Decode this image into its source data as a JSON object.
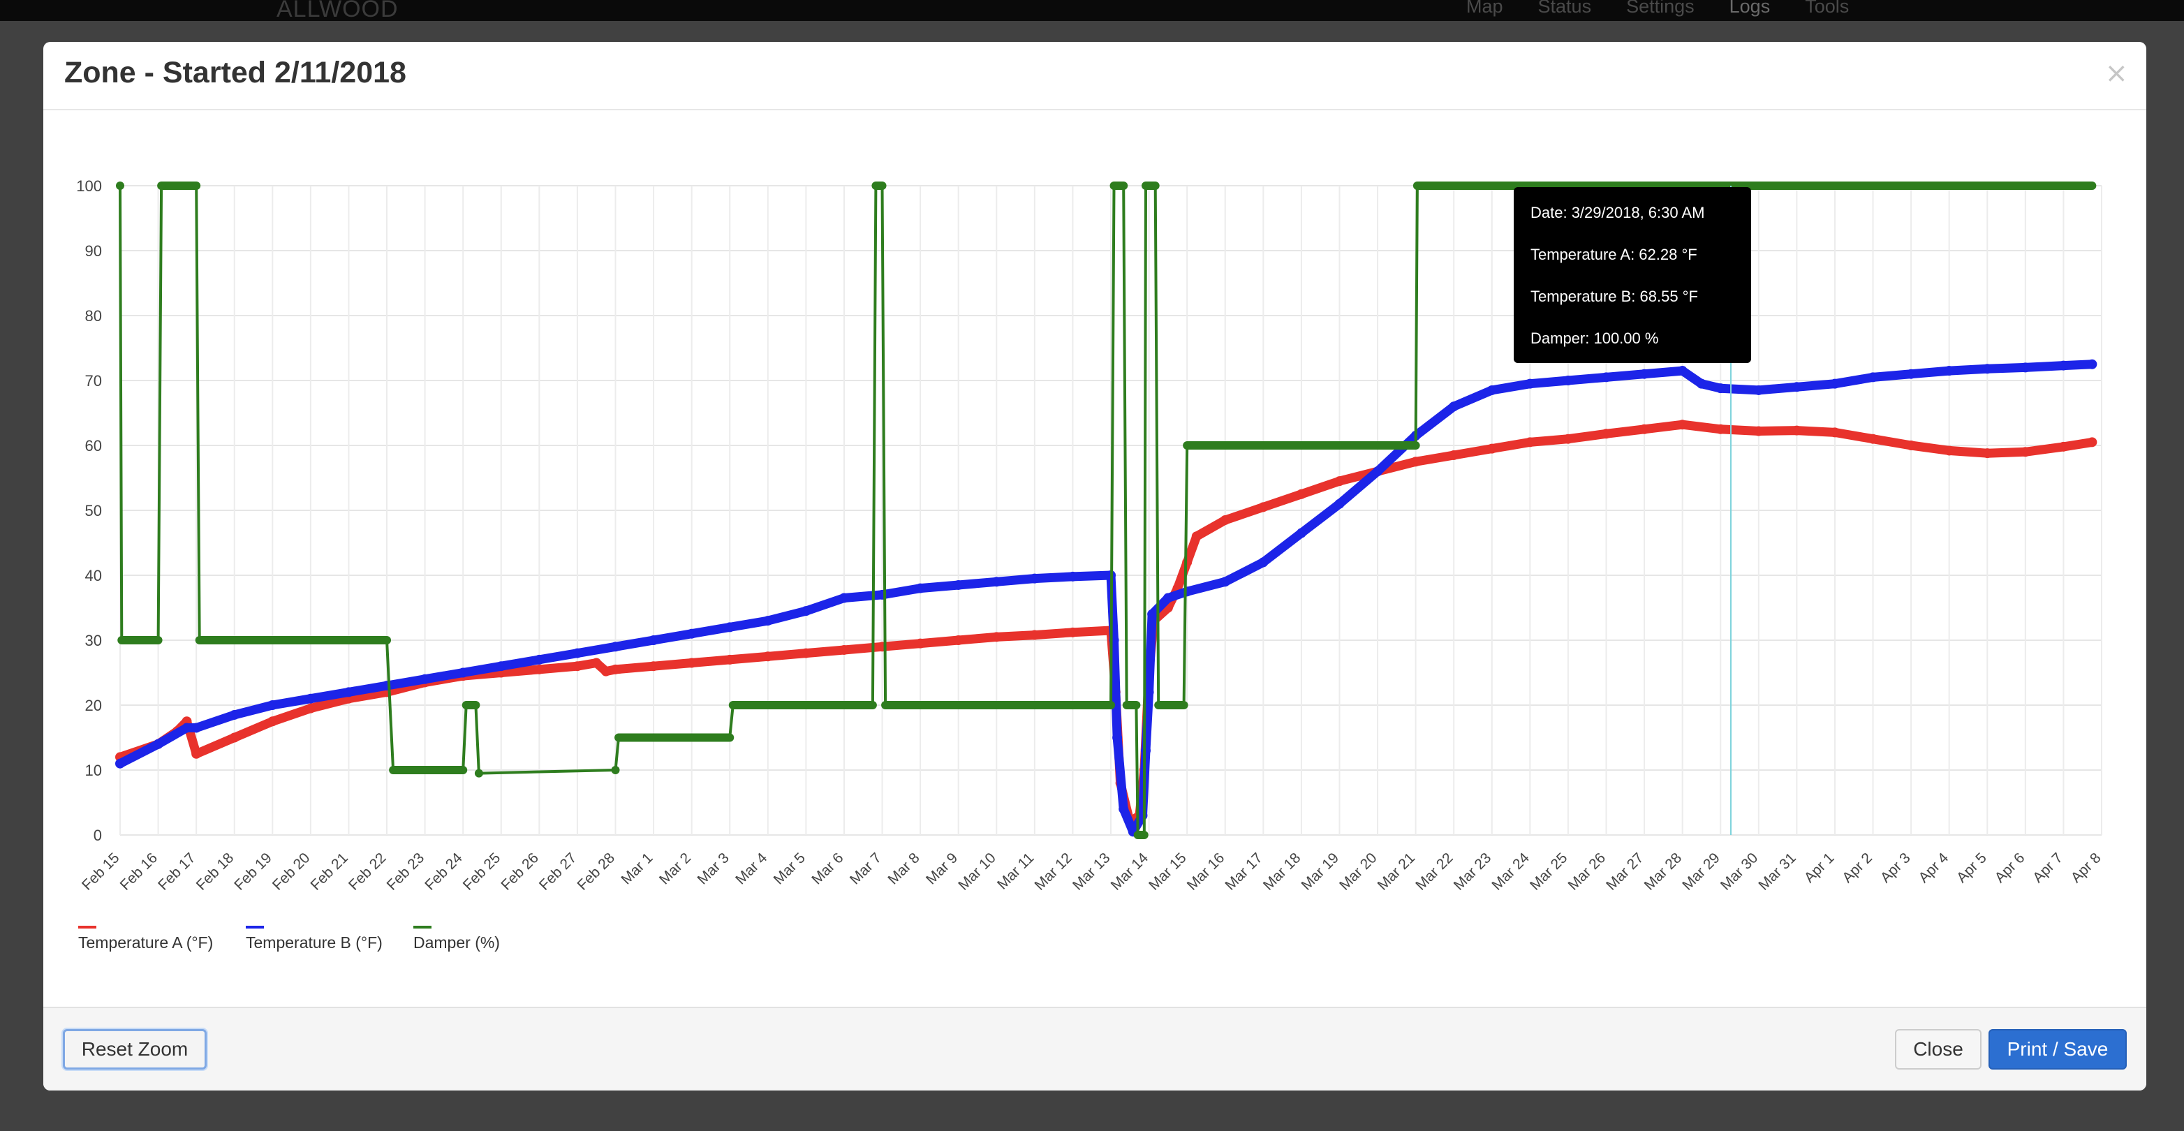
{
  "navbar": {
    "brand": "ALLWOOD",
    "items": [
      {
        "label": "Map",
        "active": false
      },
      {
        "label": "Status",
        "active": false
      },
      {
        "label": "Settings",
        "active": false
      },
      {
        "label": "Logs",
        "active": true
      },
      {
        "label": "Tools",
        "active": false
      }
    ]
  },
  "modal": {
    "title": "Zone - Started 2/11/2018",
    "close_glyph": "×"
  },
  "footer": {
    "reset_zoom_label": "Reset Zoom",
    "close_label": "Close",
    "print_save_label": "Print / Save"
  },
  "chart_data": {
    "type": "line",
    "title": "",
    "xlabel": "",
    "ylabel": "",
    "ylim": [
      0,
      100
    ],
    "yticks": [
      0,
      10,
      20,
      30,
      40,
      50,
      60,
      70,
      80,
      90,
      100
    ],
    "grid": true,
    "legend_position": "bottom-left",
    "x_tick_labels": [
      "Feb 15",
      "Feb 16",
      "Feb 17",
      "Feb 18",
      "Feb 19",
      "Feb 20",
      "Feb 21",
      "Feb 22",
      "Feb 23",
      "Feb 24",
      "Feb 25",
      "Feb 26",
      "Feb 27",
      "Feb 28",
      "Mar 1",
      "Mar 2",
      "Mar 3",
      "Mar 4",
      "Mar 5",
      "Mar 6",
      "Mar 7",
      "Mar 8",
      "Mar 9",
      "Mar 10",
      "Mar 11",
      "Mar 12",
      "Mar 13",
      "Mar 14",
      "Mar 15",
      "Mar 16",
      "Mar 17",
      "Mar 18",
      "Mar 19",
      "Mar 20",
      "Mar 21",
      "Mar 22",
      "Mar 23",
      "Mar 24",
      "Mar 25",
      "Mar 26",
      "Mar 27",
      "Mar 28",
      "Mar 29",
      "Mar 30",
      "Mar 31",
      "Apr 1",
      "Apr 2",
      "Apr 3",
      "Apr 4",
      "Apr 5",
      "Apr 6",
      "Apr 7",
      "Apr 8"
    ],
    "series": [
      {
        "name": "Temperature A (°F)",
        "color": "#e8322c",
        "points": [
          [
            "2018-02-15",
            12
          ],
          [
            "2018-02-16",
            14
          ],
          [
            "2018-02-16 12:00",
            16
          ],
          [
            "2018-02-16 18:00",
            17.5
          ],
          [
            "2018-02-17",
            12.5
          ],
          [
            "2018-02-18",
            15
          ],
          [
            "2018-02-19",
            17.5
          ],
          [
            "2018-02-20",
            19.5
          ],
          [
            "2018-02-21",
            21
          ],
          [
            "2018-02-22",
            22
          ],
          [
            "2018-02-23",
            23.5
          ],
          [
            "2018-02-24",
            24.5
          ],
          [
            "2018-02-25",
            25
          ],
          [
            "2018-02-26",
            25.5
          ],
          [
            "2018-02-27",
            26
          ],
          [
            "2018-02-27 12:00",
            26.5
          ],
          [
            "2018-02-27 18:00",
            25.2
          ],
          [
            "2018-02-28",
            25.5
          ],
          [
            "2018-03-01",
            26
          ],
          [
            "2018-03-02",
            26.5
          ],
          [
            "2018-03-03",
            27
          ],
          [
            "2018-03-04",
            27.5
          ],
          [
            "2018-03-05",
            28
          ],
          [
            "2018-03-06",
            28.5
          ],
          [
            "2018-03-07",
            29
          ],
          [
            "2018-03-08",
            29.5
          ],
          [
            "2018-03-09",
            30
          ],
          [
            "2018-03-10",
            30.5
          ],
          [
            "2018-03-11",
            30.8
          ],
          [
            "2018-03-12",
            31.2
          ],
          [
            "2018-03-13",
            31.5
          ],
          [
            "2018-03-13 03:00",
            22
          ],
          [
            "2018-03-13 06:00",
            8
          ],
          [
            "2018-03-13 12:00",
            2
          ],
          [
            "2018-03-13 18:00",
            3
          ],
          [
            "2018-03-13 21:00",
            10
          ],
          [
            "2018-03-14",
            25
          ],
          [
            "2018-03-14 03:00",
            33
          ],
          [
            "2018-03-14 12:00",
            35
          ],
          [
            "2018-03-14 18:00",
            38
          ],
          [
            "2018-03-15",
            42
          ],
          [
            "2018-03-15 06:00",
            46
          ],
          [
            "2018-03-16",
            48.5
          ],
          [
            "2018-03-17",
            50.5
          ],
          [
            "2018-03-18",
            52.5
          ],
          [
            "2018-03-19",
            54.5
          ],
          [
            "2018-03-20",
            56
          ],
          [
            "2018-03-21",
            57.5
          ],
          [
            "2018-03-22",
            58.5
          ],
          [
            "2018-03-23",
            59.5
          ],
          [
            "2018-03-24",
            60.5
          ],
          [
            "2018-03-25",
            61
          ],
          [
            "2018-03-26",
            61.8
          ],
          [
            "2018-03-27",
            62.5
          ],
          [
            "2018-03-28",
            63.2
          ],
          [
            "2018-03-29",
            62.5
          ],
          [
            "2018-03-30",
            62.2
          ],
          [
            "2018-03-31",
            62.3
          ],
          [
            "2018-04-01",
            62
          ],
          [
            "2018-04-02",
            61
          ],
          [
            "2018-04-03",
            60
          ],
          [
            "2018-04-04",
            59.2
          ],
          [
            "2018-04-05",
            58.8
          ],
          [
            "2018-04-06",
            59
          ],
          [
            "2018-04-07",
            59.8
          ],
          [
            "2018-04-07 18:00",
            60.5
          ]
        ]
      },
      {
        "name": "Temperature B (°F)",
        "color": "#1c24e8",
        "points": [
          [
            "2018-02-15",
            11
          ],
          [
            "2018-02-16",
            14
          ],
          [
            "2018-02-16 18:00",
            16.5
          ],
          [
            "2018-02-17",
            16.5
          ],
          [
            "2018-02-18",
            18.5
          ],
          [
            "2018-02-19",
            20
          ],
          [
            "2018-02-20",
            21
          ],
          [
            "2018-02-21",
            22
          ],
          [
            "2018-02-22",
            23
          ],
          [
            "2018-02-23",
            24
          ],
          [
            "2018-02-24",
            25
          ],
          [
            "2018-02-25",
            26
          ],
          [
            "2018-02-26",
            27
          ],
          [
            "2018-02-27",
            28
          ],
          [
            "2018-02-28",
            29
          ],
          [
            "2018-03-01",
            30
          ],
          [
            "2018-03-02",
            31
          ],
          [
            "2018-03-03",
            32
          ],
          [
            "2018-03-04",
            33
          ],
          [
            "2018-03-05",
            34.5
          ],
          [
            "2018-03-06",
            36.5
          ],
          [
            "2018-03-07",
            37
          ],
          [
            "2018-03-08",
            38
          ],
          [
            "2018-03-09",
            38.5
          ],
          [
            "2018-03-10",
            39
          ],
          [
            "2018-03-11",
            39.5
          ],
          [
            "2018-03-12",
            39.8
          ],
          [
            "2018-03-13",
            40
          ],
          [
            "2018-03-13 02:00",
            30
          ],
          [
            "2018-03-13 04:00",
            15
          ],
          [
            "2018-03-13 08:00",
            4
          ],
          [
            "2018-03-13 14:00",
            0.5
          ],
          [
            "2018-03-13 20:00",
            3
          ],
          [
            "2018-03-13 22:00",
            13
          ],
          [
            "2018-03-14",
            22
          ],
          [
            "2018-03-14 02:00",
            34
          ],
          [
            "2018-03-14 12:00",
            36.5
          ],
          [
            "2018-03-15",
            37.5
          ],
          [
            "2018-03-16",
            39
          ],
          [
            "2018-03-17",
            42
          ],
          [
            "2018-03-18",
            46.5
          ],
          [
            "2018-03-19",
            51
          ],
          [
            "2018-03-20",
            56
          ],
          [
            "2018-03-21",
            61.5
          ],
          [
            "2018-03-22",
            66
          ],
          [
            "2018-03-23",
            68.5
          ],
          [
            "2018-03-24",
            69.5
          ],
          [
            "2018-03-25",
            70
          ],
          [
            "2018-03-26",
            70.5
          ],
          [
            "2018-03-27",
            71
          ],
          [
            "2018-03-28",
            71.5
          ],
          [
            "2018-03-28 12:00",
            69.5
          ],
          [
            "2018-03-29",
            68.8
          ],
          [
            "2018-03-30",
            68.5
          ],
          [
            "2018-03-31",
            69
          ],
          [
            "2018-04-01",
            69.5
          ],
          [
            "2018-04-02",
            70.5
          ],
          [
            "2018-04-03",
            71
          ],
          [
            "2018-04-04",
            71.5
          ],
          [
            "2018-04-05",
            71.8
          ],
          [
            "2018-04-06",
            72
          ],
          [
            "2018-04-07",
            72.3
          ],
          [
            "2018-04-07 18:00",
            72.5
          ]
        ]
      },
      {
        "name": "Damper (%)",
        "color": "#2e7d1e",
        "points": [
          [
            "2018-02-15",
            100
          ],
          [
            "2018-02-15 01:00",
            30
          ],
          [
            "2018-02-16",
            30
          ],
          [
            "2018-02-16 02:00",
            100
          ],
          [
            "2018-02-17",
            100
          ],
          [
            "2018-02-17 02:00",
            30
          ],
          [
            "2018-02-22",
            30
          ],
          [
            "2018-02-22 04:00",
            10
          ],
          [
            "2018-02-24",
            10
          ],
          [
            "2018-02-24 02:00",
            20
          ],
          [
            "2018-02-24 08:00",
            20
          ],
          [
            "2018-02-24 10:00",
            9.5
          ],
          [
            "2018-02-28",
            10
          ],
          [
            "2018-02-28 02:00",
            15
          ],
          [
            "2018-03-03",
            15
          ],
          [
            "2018-03-03 02:00",
            20
          ],
          [
            "2018-03-06 18:00",
            20
          ],
          [
            "2018-03-06 20:00",
            100
          ],
          [
            "2018-03-07",
            100
          ],
          [
            "2018-03-07 02:00",
            20
          ],
          [
            "2018-03-13",
            20
          ],
          [
            "2018-03-13 02:00",
            100
          ],
          [
            "2018-03-13 08:00",
            100
          ],
          [
            "2018-03-13 10:00",
            20
          ],
          [
            "2018-03-13 16:00",
            20
          ],
          [
            "2018-03-13 17:00",
            0
          ],
          [
            "2018-03-13 21:00",
            0
          ],
          [
            "2018-03-13 22:00",
            100
          ],
          [
            "2018-03-14 04:00",
            100
          ],
          [
            "2018-03-14 06:00",
            20
          ],
          [
            "2018-03-14 22:00",
            20
          ],
          [
            "2018-03-15",
            60
          ],
          [
            "2018-03-21",
            60
          ],
          [
            "2018-03-21 01:00",
            100
          ],
          [
            "2018-04-07 18:00",
            100
          ]
        ]
      }
    ],
    "tooltip": {
      "date": "Date: 3/29/2018, 6:30 AM",
      "temp_a": "Temperature A: 62.28 °F",
      "temp_b": "Temperature B: 68.55 °F",
      "damper": "Damper: 100.00 %"
    }
  }
}
